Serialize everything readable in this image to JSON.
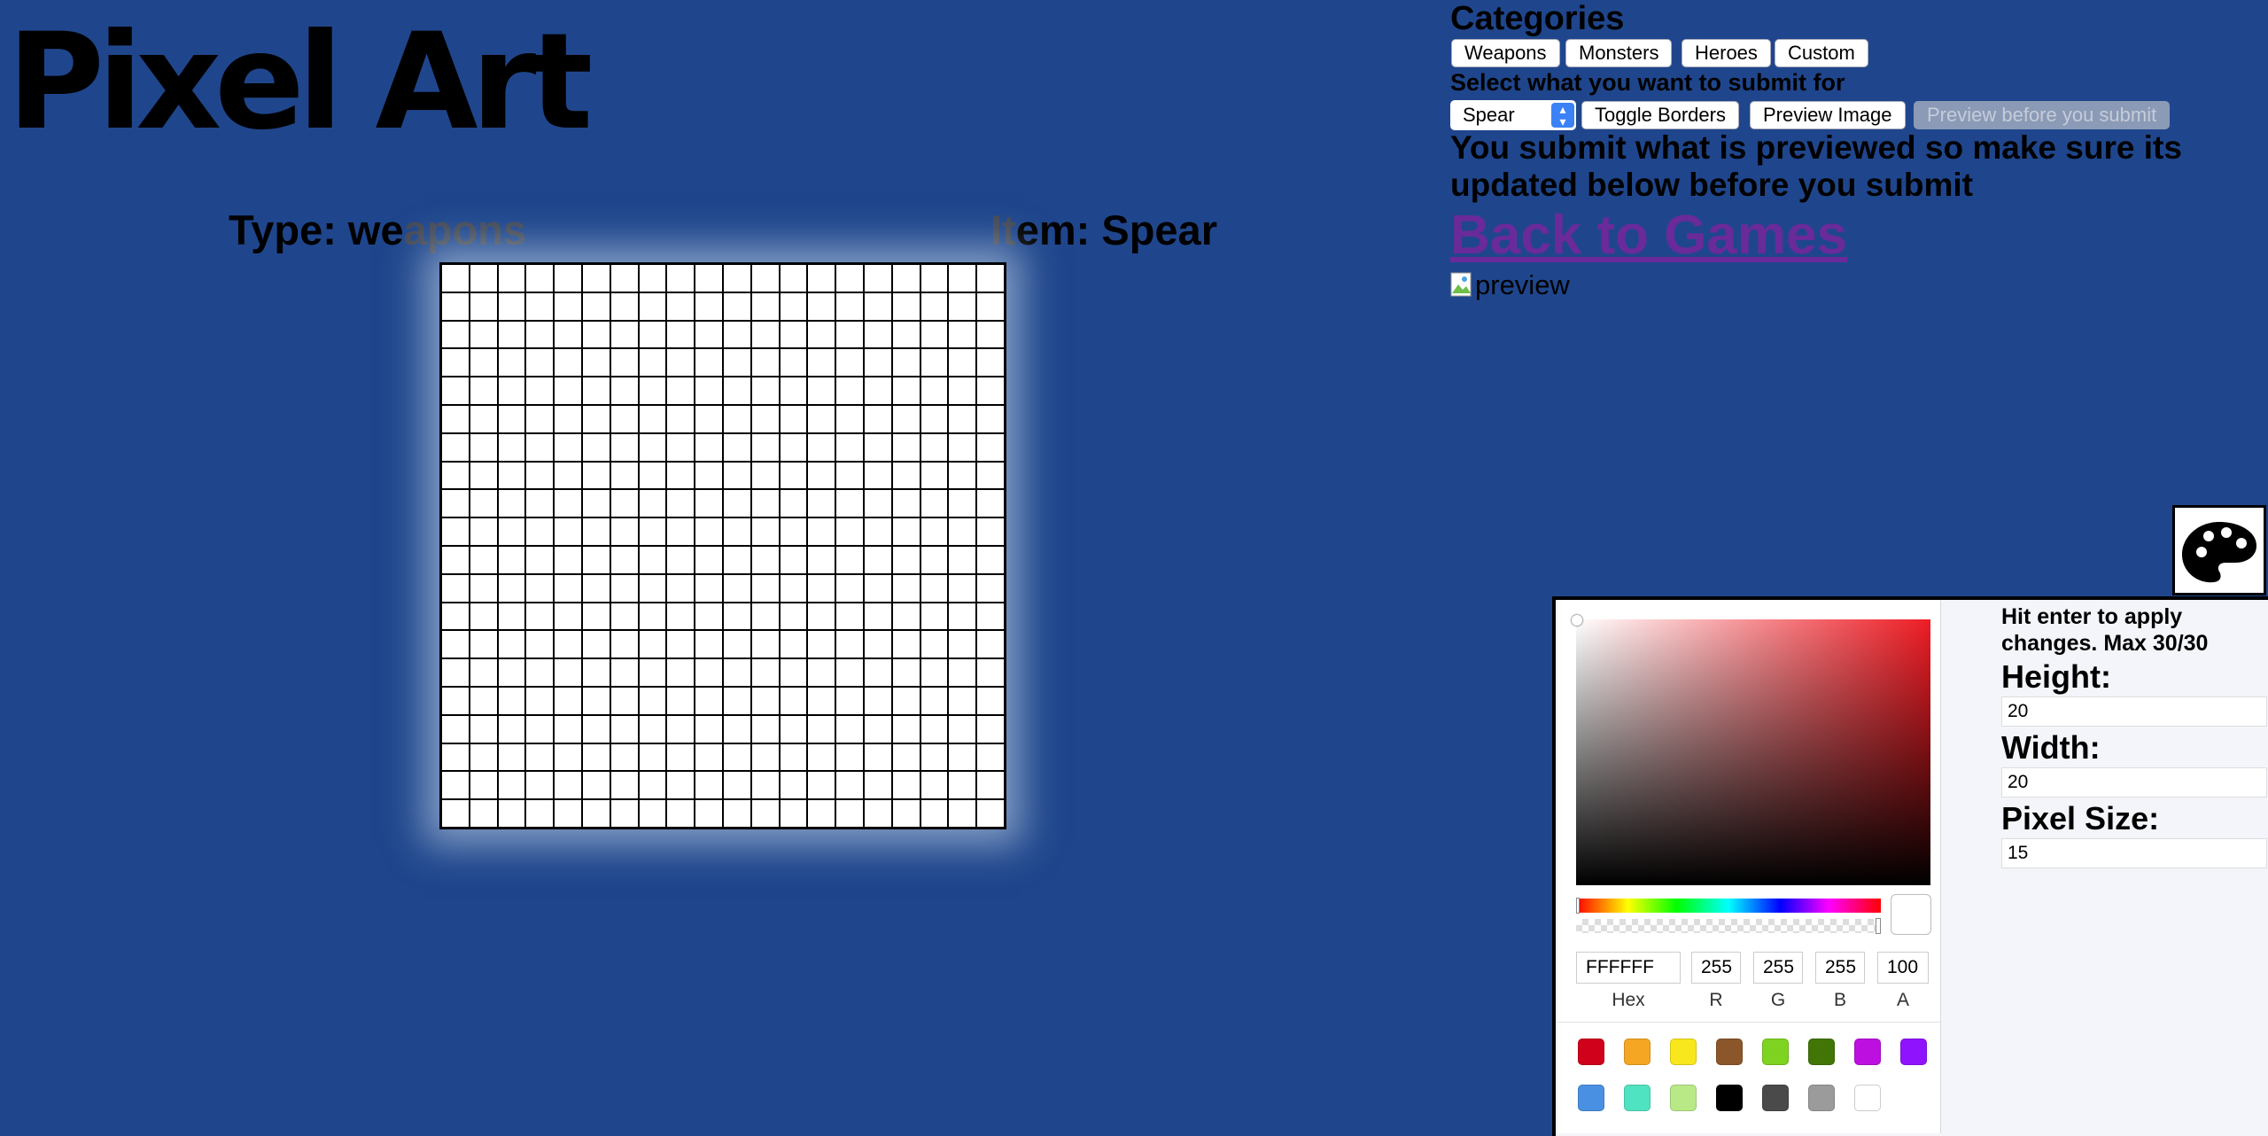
{
  "title": "Pixel Art",
  "canvas": {
    "type_prefix": "Type: we",
    "type_suffix": "apons",
    "item_prefix": "It",
    "item_suffix": "em: Spear",
    "grid_rows": 20,
    "grid_cols": 20
  },
  "panel": {
    "categories_title": "Categories",
    "category_buttons": [
      "Weapons",
      "Monsters",
      "Heroes",
      "Custom"
    ],
    "select_label": "Select what you want to submit for",
    "selected_item": "Spear",
    "toggle_borders": "Toggle Borders",
    "preview_image": "Preview Image",
    "preview_before_submit": "Preview before you submit",
    "notice": "You submit what is previewed so make sure its updated below before you submit",
    "back_link": "Back to Games",
    "preview_alt": "preview"
  },
  "palette_toggle_icon": "palette-icon",
  "color_picker": {
    "hex": "FFFFFF",
    "r": "255",
    "g": "255",
    "b": "255",
    "a": "100",
    "labels": {
      "hex": "Hex",
      "r": "R",
      "g": "G",
      "b": "B",
      "a": "A"
    },
    "presets": [
      "#D0021B",
      "#F5A623",
      "#F8E71C",
      "#8B572A",
      "#7ED321",
      "#417505",
      "#BD10E0",
      "#9013FE",
      "#4A90E2",
      "#50E3C2",
      "#B8E986",
      "#000000",
      "#4A4A4A",
      "#9B9B9B",
      "#FFFFFF"
    ]
  },
  "settings": {
    "hint": "Hit enter to apply changes. Max 30/30",
    "height_label": "Height:",
    "height_value": "20",
    "width_label": "Width:",
    "width_value": "20",
    "pixel_size_label": "Pixel Size:",
    "pixel_size_value": "15"
  },
  "colors": {
    "background": "#1F468C",
    "link_visited": "#6A2A9A"
  }
}
